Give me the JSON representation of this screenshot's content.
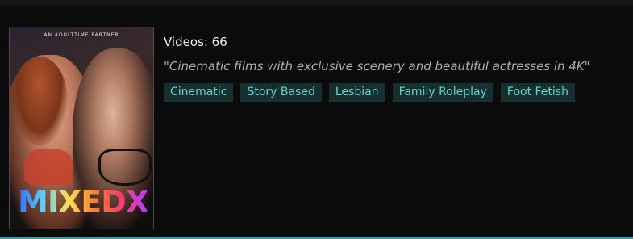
{
  "poster": {
    "partner_line": "AN ADULTTIME PARTNER",
    "logo_text": "MIXEDX",
    "alt": "MixedX"
  },
  "channel": {
    "videos_label": "Videos: 66",
    "tagline": "\"Cinematic films with exclusive scenery and beautiful actresses in 4K\""
  },
  "tags": [
    "Cinematic",
    "Story Based",
    "Lesbian",
    "Family Roleplay",
    "Foot Fetish"
  ],
  "colors": {
    "background": "#0b0b0c",
    "tag_bg": "#15302f",
    "tag_text": "#5fd6cf",
    "accent": "#2f9c9f"
  }
}
